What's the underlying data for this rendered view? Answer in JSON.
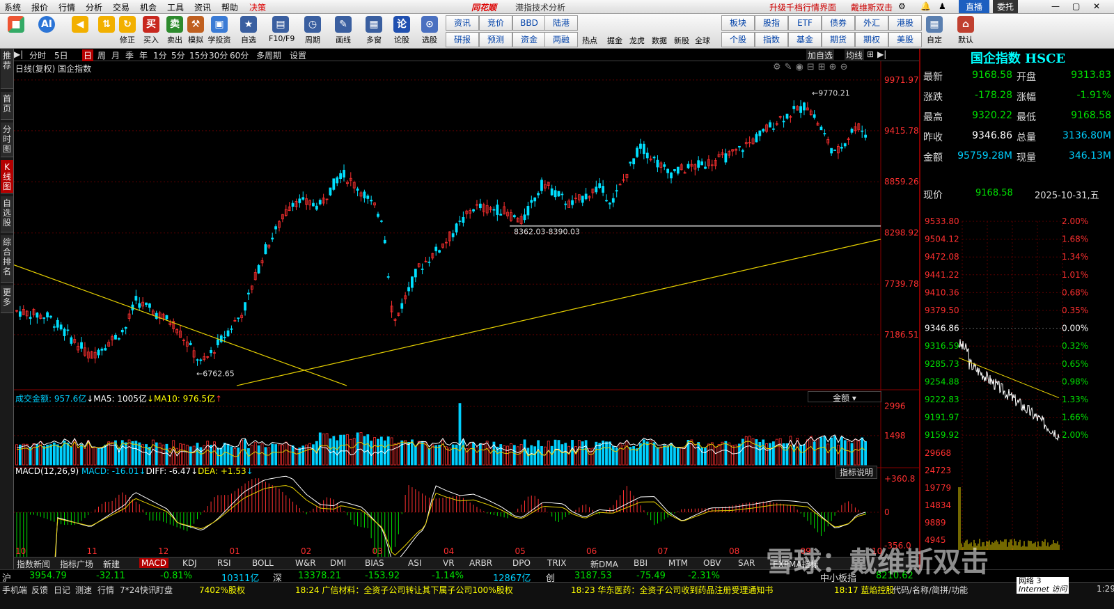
{
  "menu": [
    "系统",
    "报价",
    "行情",
    "分析",
    "交易",
    "机会",
    "工具",
    "资讯",
    "帮助",
    "决策"
  ],
  "app_title": "港指技术分析",
  "brand": "同花顺",
  "upgrade_link": "升级千档行情界面",
  "user_name": "戴维斯双击",
  "direct_label": "直播",
  "delegate_label": "委托",
  "toolbar": {
    "buttons": [
      "修正",
      "买入",
      "卖出",
      "模拟",
      "学投资",
      "自选",
      "F10/F9",
      "周期",
      "画线",
      "多窗",
      "论股",
      "选股"
    ],
    "grid": [
      [
        "资讯",
        "竞价",
        "BBD",
        "陆港",
        "热点",
        "掘金",
        "龙虎",
        "数据",
        "新股",
        "全球"
      ],
      [
        "研报",
        "预测",
        "资金",
        "两融"
      ]
    ],
    "grid2": [
      [
        "板块",
        "股指",
        "ETF",
        "债券",
        "外汇",
        "港股"
      ],
      [
        "个股",
        "指数",
        "基金",
        "期货",
        "期权",
        "美股"
      ]
    ],
    "right": [
      "自定",
      "默认"
    ]
  },
  "sidebar": [
    "推荐",
    "首页",
    "分时图",
    "K线图",
    "自选股",
    "综合排名",
    "更多"
  ],
  "periods": [
    "分时",
    "5日",
    "日",
    "周",
    "月",
    "季",
    "年",
    "1分",
    "5分",
    "15分",
    "30分",
    "60分",
    "多周期",
    "设置"
  ],
  "period_active": "日",
  "chart_right_btns": [
    "加自选",
    "均线"
  ],
  "chart_title": "日线(复权)  国企指数",
  "chart_data": {
    "type": "candlestick",
    "title": "国企指数",
    "price_axis": [
      9971.97,
      9415.78,
      8859.26,
      8298.92,
      7739.78,
      7186.51
    ],
    "ylim": [
      6600,
      10100
    ],
    "x_months": [
      "10",
      "11",
      "12",
      "01",
      "02",
      "03",
      "04",
      "05",
      "06",
      "07",
      "08",
      "09",
      "10"
    ],
    "annotations": {
      "high": "9770.21",
      "low": "6762.65",
      "zone": "8362.03-8390.03"
    },
    "volume_label": "成交金额: 957.6亿",
    "ma5_label": "MA5: 1005亿",
    "ma10_label": "MA10: 976.5亿",
    "volume_axis": [
      2996,
      1498
    ],
    "volume_selector": "金额",
    "macd_label": "MACD(12,26,9)",
    "macd_val": "MACD: -16.01",
    "diff_val": "DIFF: -6.47",
    "dea_val": "DEA: +1.53",
    "macd_axis": [
      "+360.8",
      "0",
      "-356.0"
    ],
    "indicator_btn": "指标说明"
  },
  "quote": {
    "title": "国企指数 HSCE",
    "rows": [
      {
        "l1": "最新",
        "v1": "9168.58",
        "c1": "#00e000",
        "l2": "开盘",
        "v2": "9313.83",
        "c2": "#00e000"
      },
      {
        "l1": "涨跌",
        "v1": "-178.28",
        "c1": "#00e000",
        "l2": "涨幅",
        "v2": "-1.91%",
        "c2": "#00e000"
      },
      {
        "l1": "最高",
        "v1": "9320.22",
        "c1": "#00e000",
        "l2": "最低",
        "v2": "9168.58",
        "c2": "#00e000"
      },
      {
        "l1": "昨收",
        "v1": "9346.86",
        "c1": "#ffffff",
        "l2": "总量",
        "v2": "3136.80M",
        "c2": "#00d0ff"
      },
      {
        "l1": "金额",
        "v1": "95759.28M",
        "c1": "#00d0ff",
        "l2": "现量",
        "v2": "346.13M",
        "c2": "#00d0ff"
      }
    ],
    "now_label": "现价",
    "now_val": "9168.58",
    "date": "2025-10-31,五",
    "intraday": {
      "prices": [
        "9533.80",
        "9504.12",
        "9472.08",
        "9441.22",
        "9410.36",
        "9379.50",
        "9346.86",
        "9316.59",
        "9285.73",
        "9254.88",
        "9222.83",
        "9191.97",
        "9159.92"
      ],
      "pcts": [
        "2.00%",
        "1.68%",
        "1.34%",
        "1.01%",
        "0.68%",
        "0.35%",
        "0.00%",
        "0.32%",
        "0.65%",
        "0.98%",
        "1.33%",
        "1.66%",
        "2.00%"
      ],
      "vols": [
        "29668",
        "24723",
        "19779",
        "14834",
        "9889",
        "4945"
      ]
    }
  },
  "bottom_tabs": [
    "指数新闻",
    "指标广场",
    "新建",
    "MACD",
    "KDJ",
    "RSI",
    "BOLL",
    "W&R",
    "DMI",
    "BIAS",
    "ASI",
    "VR",
    "ARBR",
    "DPO",
    "TRIX",
    "新DMA",
    "BBI",
    "MTM",
    "OBV",
    "SAR",
    "EXPMA指标"
  ],
  "bottom_active": "MACD",
  "index_bar": [
    {
      "t": "沪",
      "c": "#ddd"
    },
    {
      "t": "3954.79",
      "c": "#00e000"
    },
    {
      "t": "-32.11",
      "c": "#00e000"
    },
    {
      "t": "-0.81%",
      "c": "#00e000"
    },
    {
      "t": "10311亿",
      "c": "#00d0ff"
    },
    {
      "t": "深",
      "c": "#ddd"
    },
    {
      "t": "13378.21",
      "c": "#00e000"
    },
    {
      "t": "-153.92",
      "c": "#00e000"
    },
    {
      "t": "-1.14%",
      "c": "#00e000"
    },
    {
      "t": "12867亿",
      "c": "#00d0ff"
    },
    {
      "t": "创",
      "c": "#ddd"
    },
    {
      "t": "3187.53",
      "c": "#00e000"
    },
    {
      "t": "-75.49",
      "c": "#00e000"
    },
    {
      "t": "-2.31%",
      "c": "#00e000"
    },
    {
      "t": "中小板指",
      "c": "#ddd"
    },
    {
      "t": "8210.62",
      "c": "#00e000"
    }
  ],
  "news_bar": [
    "手机端",
    "反馈",
    "日记",
    "测速",
    "行情",
    "7*24快讯",
    "盯盘",
    "7402%股权",
    "18:24 广信材料：全资子公司转让其下属子公司100%股权",
    "18:23 华东医药：全资子公司收到药品注册受理通知书",
    "18:17 蓝焰控股",
    "代码/名称/简拼/功能"
  ],
  "status": {
    "net": "网络 3",
    "net_sub": "Internet 访问",
    "time": "1:29"
  },
  "watermark": "雪球：戴维斯双击"
}
